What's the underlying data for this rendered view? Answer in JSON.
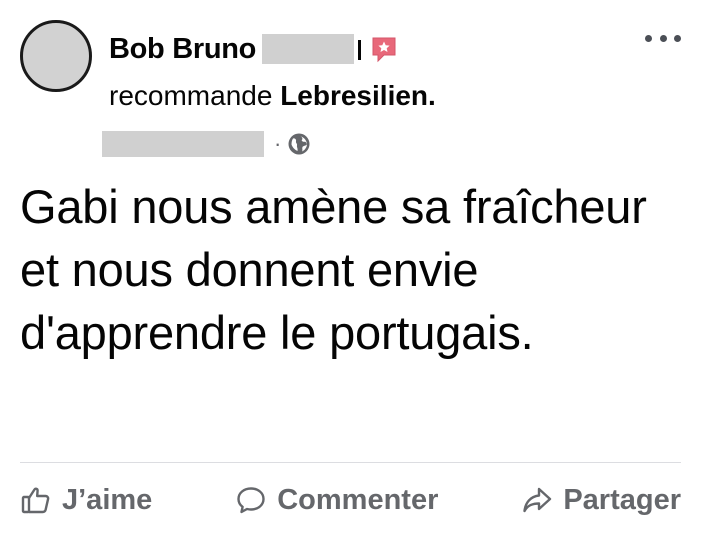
{
  "post": {
    "author_name": "Bob Bruno",
    "recommends_text": "recommande",
    "page_name": "Lebresilien.",
    "separator": "·",
    "body": "Gabi nous amène sa fraîcheur et nous donnent envie d'apprendre le portugais."
  },
  "icons": {
    "avatar": "avatar",
    "badge": "recommendation-star-icon",
    "privacy": "globe-icon",
    "more": "more-options-icon",
    "like": "thumbs-up-icon",
    "comment": "comment-bubble-icon",
    "share": "share-arrow-icon"
  },
  "actions": {
    "like_label": "J’aime",
    "comment_label": "Commenter",
    "share_label": "Partager"
  },
  "colors": {
    "badge": "#e8687a",
    "secondary_text": "#65676b",
    "primary_text": "#050505"
  }
}
